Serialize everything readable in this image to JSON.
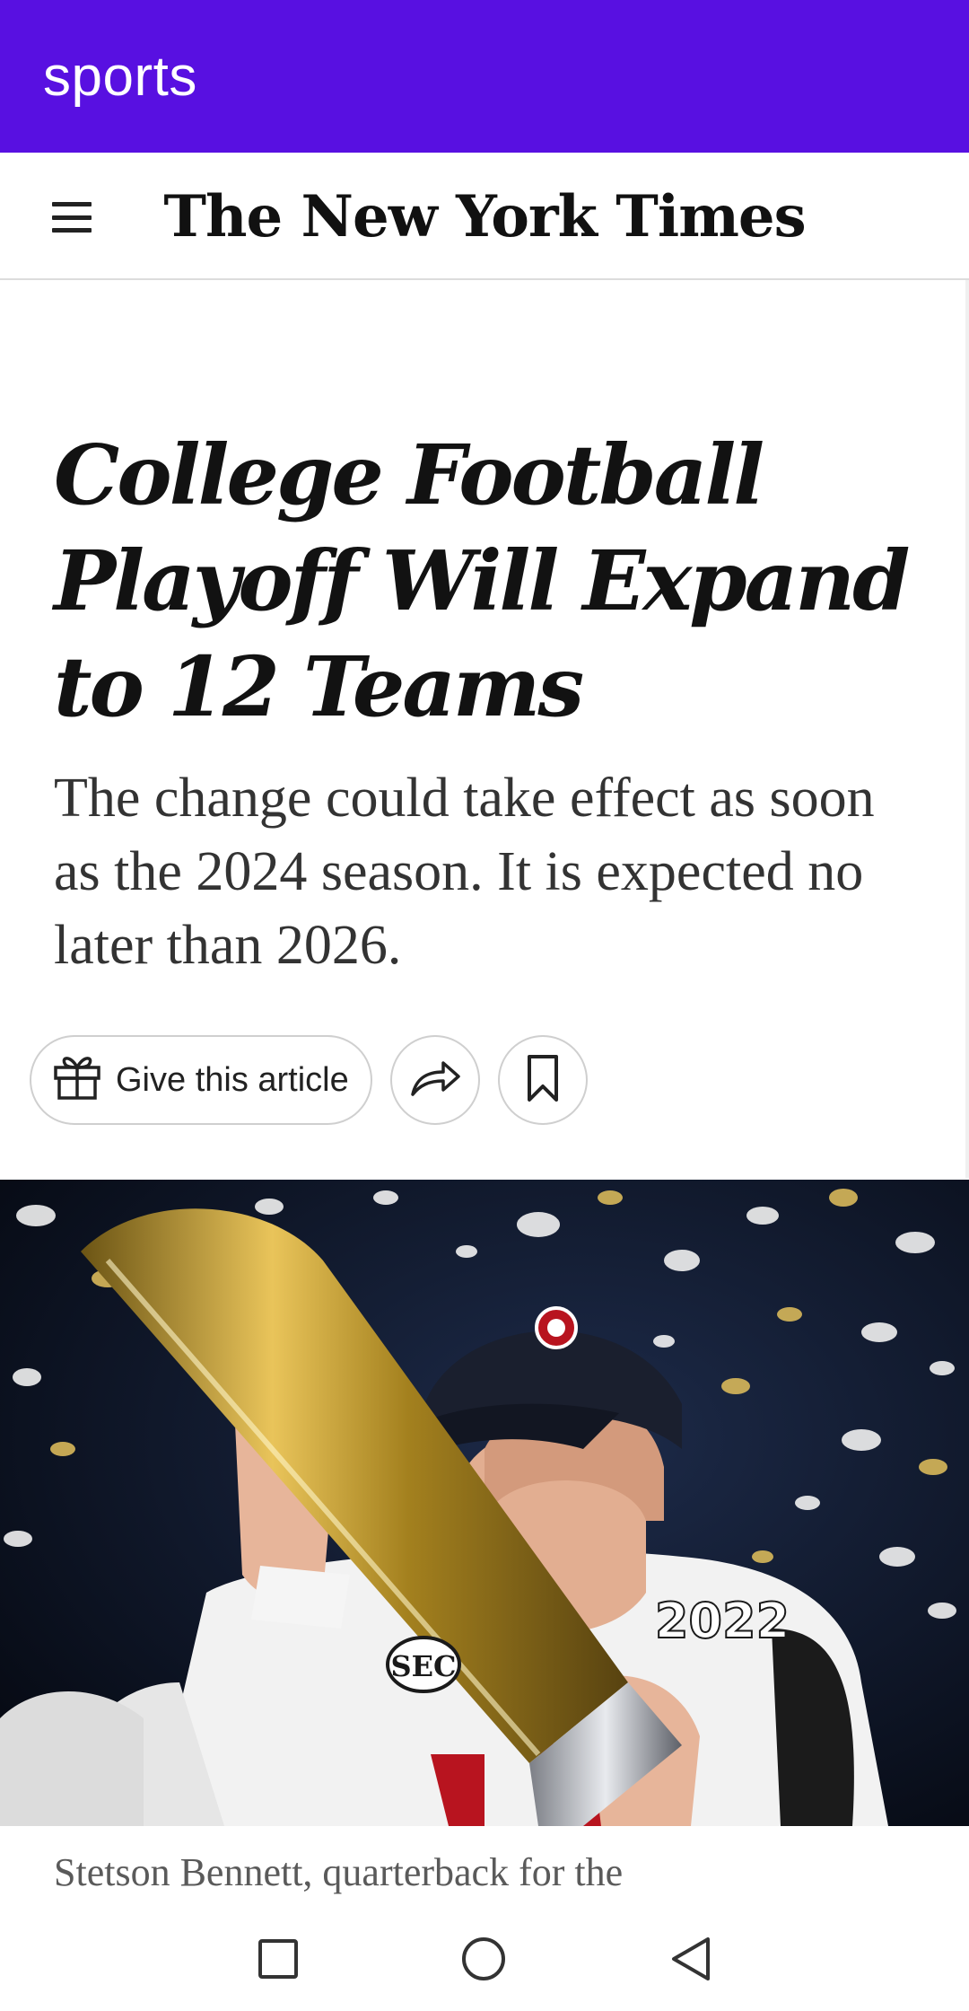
{
  "app_bar": {
    "title": "sports",
    "background": "#5810e1"
  },
  "header": {
    "menu_icon": "hamburger-menu-icon",
    "masthead": "The New York Times"
  },
  "article": {
    "headline": "College Football Playoff Will Expand to 12 Teams",
    "summary": "The change could take effect as soon as the 2024 season. It is expected no later than 2026.",
    "actions": {
      "gift_label": "Give this article",
      "gift_icon": "gift-icon",
      "share_icon": "share-arrow-icon",
      "bookmark_icon": "bookmark-icon"
    },
    "photo": {
      "jersey_patch": "2022",
      "conference_patch": "SEC"
    },
    "caption": "Stetson Bennett, quarterback for the"
  },
  "system_nav": {
    "recents_icon": "square-recents-icon",
    "home_icon": "circle-home-icon",
    "back_icon": "triangle-back-icon"
  }
}
